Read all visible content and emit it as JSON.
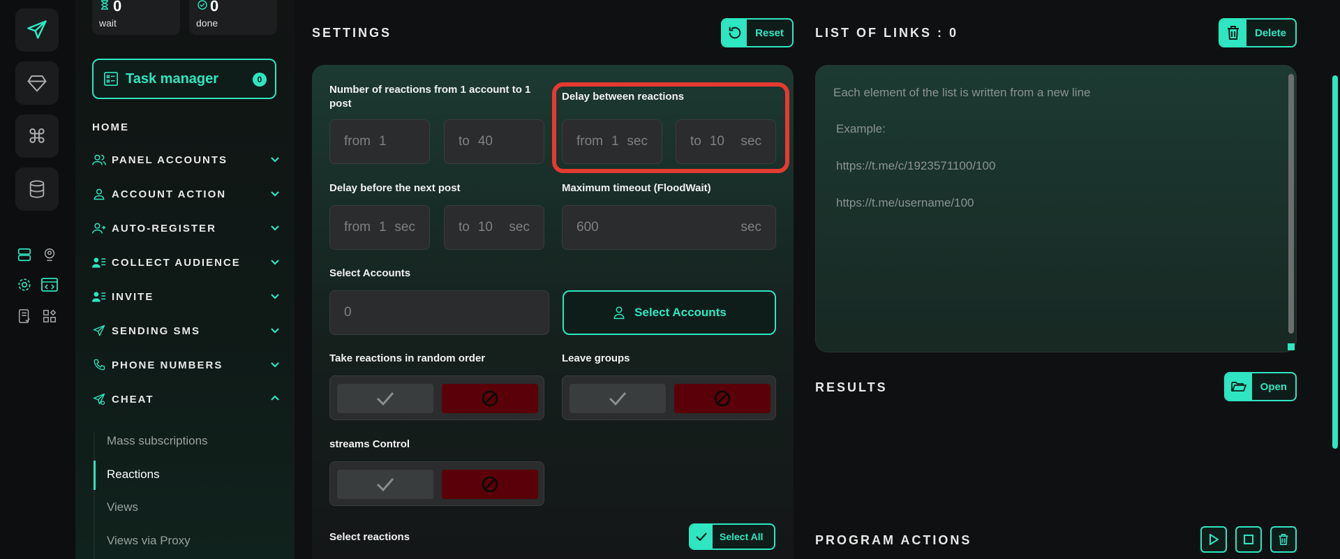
{
  "colors": {
    "accent": "#2ee6c1",
    "danger": "#5a0008",
    "highlight": "#e53a32"
  },
  "sidebar": {
    "stats": [
      {
        "value": "0",
        "label": "wait",
        "icon": "hourglass-icon"
      },
      {
        "value": "0",
        "label": "done",
        "icon": "check-circle-icon"
      }
    ],
    "task_manager": {
      "label": "Task manager",
      "count": "0"
    },
    "home": "HOME",
    "nav": [
      {
        "label": "PANEL ACCOUNTS",
        "icon": "users-icon"
      },
      {
        "label": "ACCOUNT ACTION",
        "icon": "user-icon"
      },
      {
        "label": "AUTO-REGISTER",
        "icon": "user-plus-icon"
      },
      {
        "label": "COLLECT AUDIENCE",
        "icon": "user-list-icon"
      },
      {
        "label": "INVITE",
        "icon": "user-list-icon"
      },
      {
        "label": "SENDING SMS",
        "icon": "send-icon"
      },
      {
        "label": "PHONE NUMBERS",
        "icon": "phone-icon"
      },
      {
        "label": "CHEAT",
        "icon": "cheat-icon"
      }
    ],
    "cheat_items": [
      "Mass subscriptions",
      "Reactions",
      "Views",
      "Views via Proxy"
    ]
  },
  "settings": {
    "title": "SETTINGS",
    "reset_label": "Reset",
    "reactions_label": "Number of reactions from 1 account to 1 post",
    "reactions_from": {
      "prefix": "from",
      "value": "1"
    },
    "reactions_to": {
      "prefix": "to",
      "value": "40"
    },
    "delay_reactions_label": "Delay between reactions",
    "delay_reactions_from": {
      "prefix": "from",
      "value": "1",
      "unit": "sec"
    },
    "delay_reactions_to": {
      "prefix": "to",
      "value": "10",
      "unit": "sec"
    },
    "delay_post_label": "Delay before the next post",
    "delay_post_from": {
      "prefix": "from",
      "value": "1",
      "unit": "sec"
    },
    "delay_post_to": {
      "prefix": "to",
      "value": "10",
      "unit": "sec"
    },
    "timeout_label": "Maximum timeout (FloodWait)",
    "timeout": {
      "value": "600",
      "unit": "sec"
    },
    "select_accounts_label": "Select Accounts",
    "select_accounts_value": "0",
    "select_accounts_button": "Select Accounts",
    "random_order_label": "Take reactions in random order",
    "leave_groups_label": "Leave groups",
    "streams_label": "streams Control",
    "select_reactions_label": "Select reactions",
    "select_all_label": "Select All"
  },
  "links": {
    "title": "LIST OF LINKS : 0",
    "delete_label": "Delete",
    "placeholder_lines": [
      "Each element of the list is written from a new line",
      "Example:",
      "https://t.me/c/1923571100/100",
      "https://t.me/username/100"
    ]
  },
  "results": {
    "title": "RESULTS",
    "open_label": "Open"
  },
  "program_actions": {
    "title": "PROGRAM ACTIONS"
  }
}
